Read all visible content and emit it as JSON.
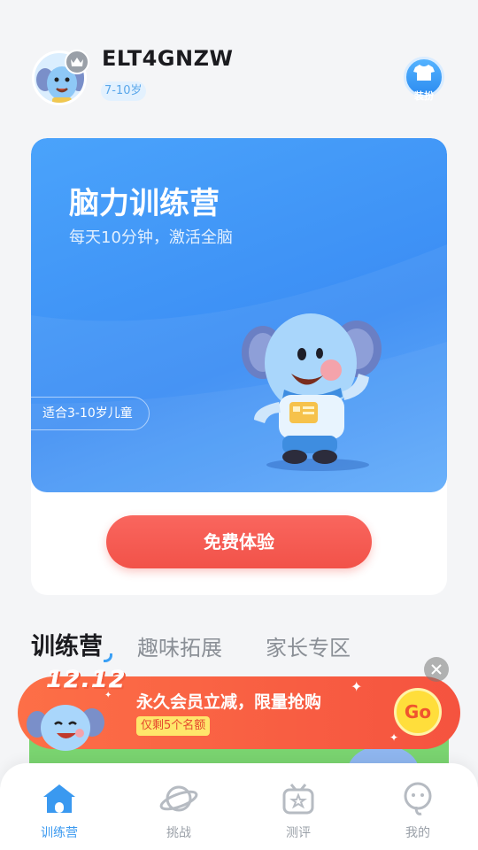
{
  "header": {
    "username": "ELT4GNZW",
    "age": "7-10岁",
    "dress_label": "装扮"
  },
  "banner": {
    "title": "脑力训练营",
    "subtitle": "每天10分钟，激活全脑",
    "age_tag": "适合3-10岁儿童",
    "cta": "免费体验"
  },
  "tabs": [
    {
      "label": "训练营",
      "active": true
    },
    {
      "label": "趣味拓展",
      "active": false
    },
    {
      "label": "家长专区",
      "active": false
    }
  ],
  "promo": {
    "date": "12.12",
    "title": "永久会员立减，限量抢购",
    "subtitle": "仅剩5个名额",
    "go": "Go"
  },
  "nav": [
    {
      "label": "训练营",
      "icon": "home-icon",
      "active": true
    },
    {
      "label": "挑战",
      "icon": "planet-icon",
      "active": false
    },
    {
      "label": "测评",
      "icon": "tv-star-icon",
      "active": false
    },
    {
      "label": "我的",
      "icon": "mascot-head-icon",
      "active": false
    }
  ],
  "colors": {
    "accent": "#3a99f0",
    "banner": "#4aa3fb",
    "cta": "#f25249",
    "promo": "#f5533f"
  }
}
